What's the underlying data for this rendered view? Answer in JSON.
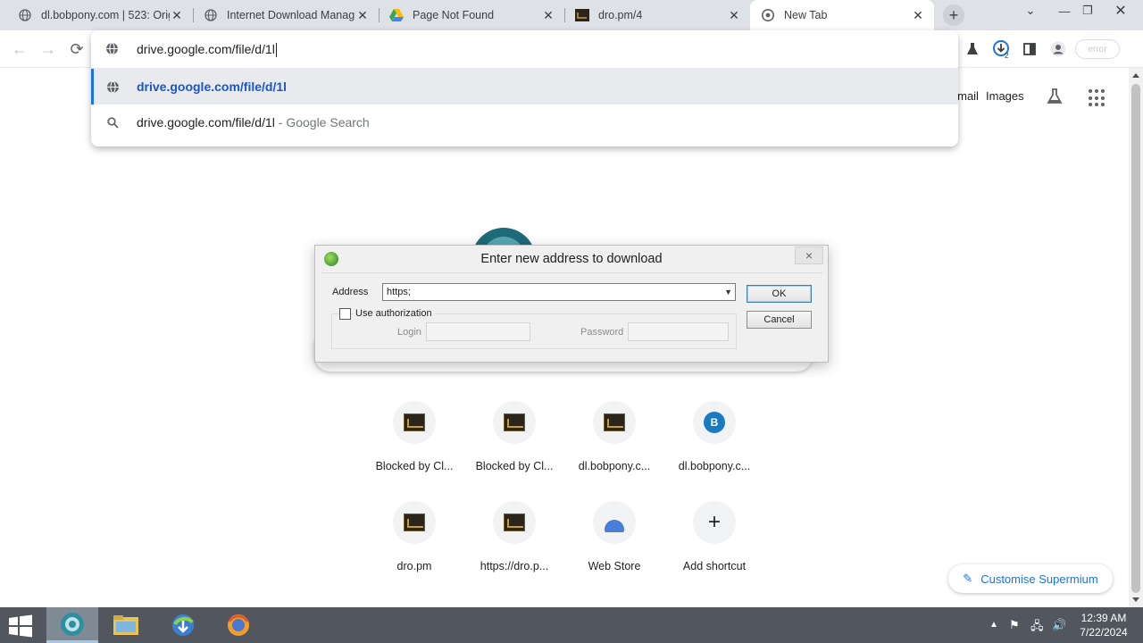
{
  "browser": {
    "tabs": [
      {
        "title": "dl.bobpony.com | 523: Orig",
        "favicon": "globe-icon",
        "active": false
      },
      {
        "title": "Internet Download Manag",
        "favicon": "globe-icon",
        "active": false
      },
      {
        "title": "Page Not Found",
        "favicon": "google-drive-icon",
        "active": false
      },
      {
        "title": "dro.pm/4",
        "favicon": "site-favicon",
        "active": false
      },
      {
        "title": "New Tab",
        "favicon": "chrome-icon",
        "active": true
      }
    ],
    "new_tab_label": "+"
  },
  "omnibox": {
    "value": "drive.google.com/file/d/1l",
    "suggestions": [
      {
        "text": "drive.google.com/file/d/1l",
        "suffix": "",
        "icon": "globe-icon",
        "selected": true
      },
      {
        "text": "drive.google.com/file/d/1l",
        "suffix": " - Google Search",
        "icon": "search-icon",
        "selected": false
      }
    ]
  },
  "toolbar": {
    "profile_chip": "error",
    "download_badge": "2"
  },
  "page": {
    "links": {
      "gmail": "Gmail",
      "images": "Images"
    },
    "shortcuts": [
      {
        "label": "Blocked by Cl...",
        "icon": "site-favicon"
      },
      {
        "label": "Blocked by Cl...",
        "icon": "site-favicon"
      },
      {
        "label": "dl.bobpony.c...",
        "icon": "site-favicon"
      },
      {
        "label": "dl.bobpony.c...",
        "icon": "letter-b-icon",
        "letter": "B"
      },
      {
        "label": "dro.pm",
        "icon": "site-favicon"
      },
      {
        "label": "https://dro.p...",
        "icon": "site-favicon"
      },
      {
        "label": "Web Store",
        "icon": "web-store-icon"
      },
      {
        "label": "Add shortcut",
        "icon": "plus-icon",
        "glyph": "+"
      }
    ],
    "customise_label": "Customise Supermium"
  },
  "dialog": {
    "title": "Enter new address to download",
    "address_label": "Address",
    "address_value": "https;",
    "use_auth_label": "Use authorization",
    "login_label": "Login",
    "password_label": "Password",
    "ok_label": "OK",
    "cancel_label": "Cancel",
    "close_glyph": "×"
  },
  "taskbar": {
    "time": "12:39 AM",
    "date": "7/22/2024"
  }
}
